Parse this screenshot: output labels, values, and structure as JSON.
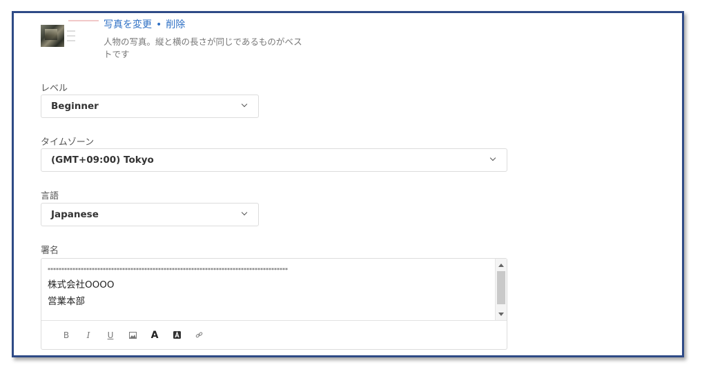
{
  "photo": {
    "change_label": "写真を変更",
    "separator": "•",
    "delete_label": "削除",
    "hint": "人物の写真。縦と横の長さが同じであるものがベストです"
  },
  "level": {
    "label": "レベル",
    "value": "Beginner"
  },
  "timezone": {
    "label": "タイムゾーン",
    "value": "(GMT+09:00) Tokyo"
  },
  "language": {
    "label": "言語",
    "value": "Japanese"
  },
  "signature": {
    "label": "署名",
    "stars": "***************************************************************************************",
    "line1": "株式会社OOOO",
    "line2": "営業本部",
    "toolbar": {
      "bold": "B",
      "italic": "I",
      "underline": "U",
      "font_color": "A"
    }
  },
  "colors": {
    "link": "#2d6fc4",
    "frame": "#2e4a86"
  }
}
